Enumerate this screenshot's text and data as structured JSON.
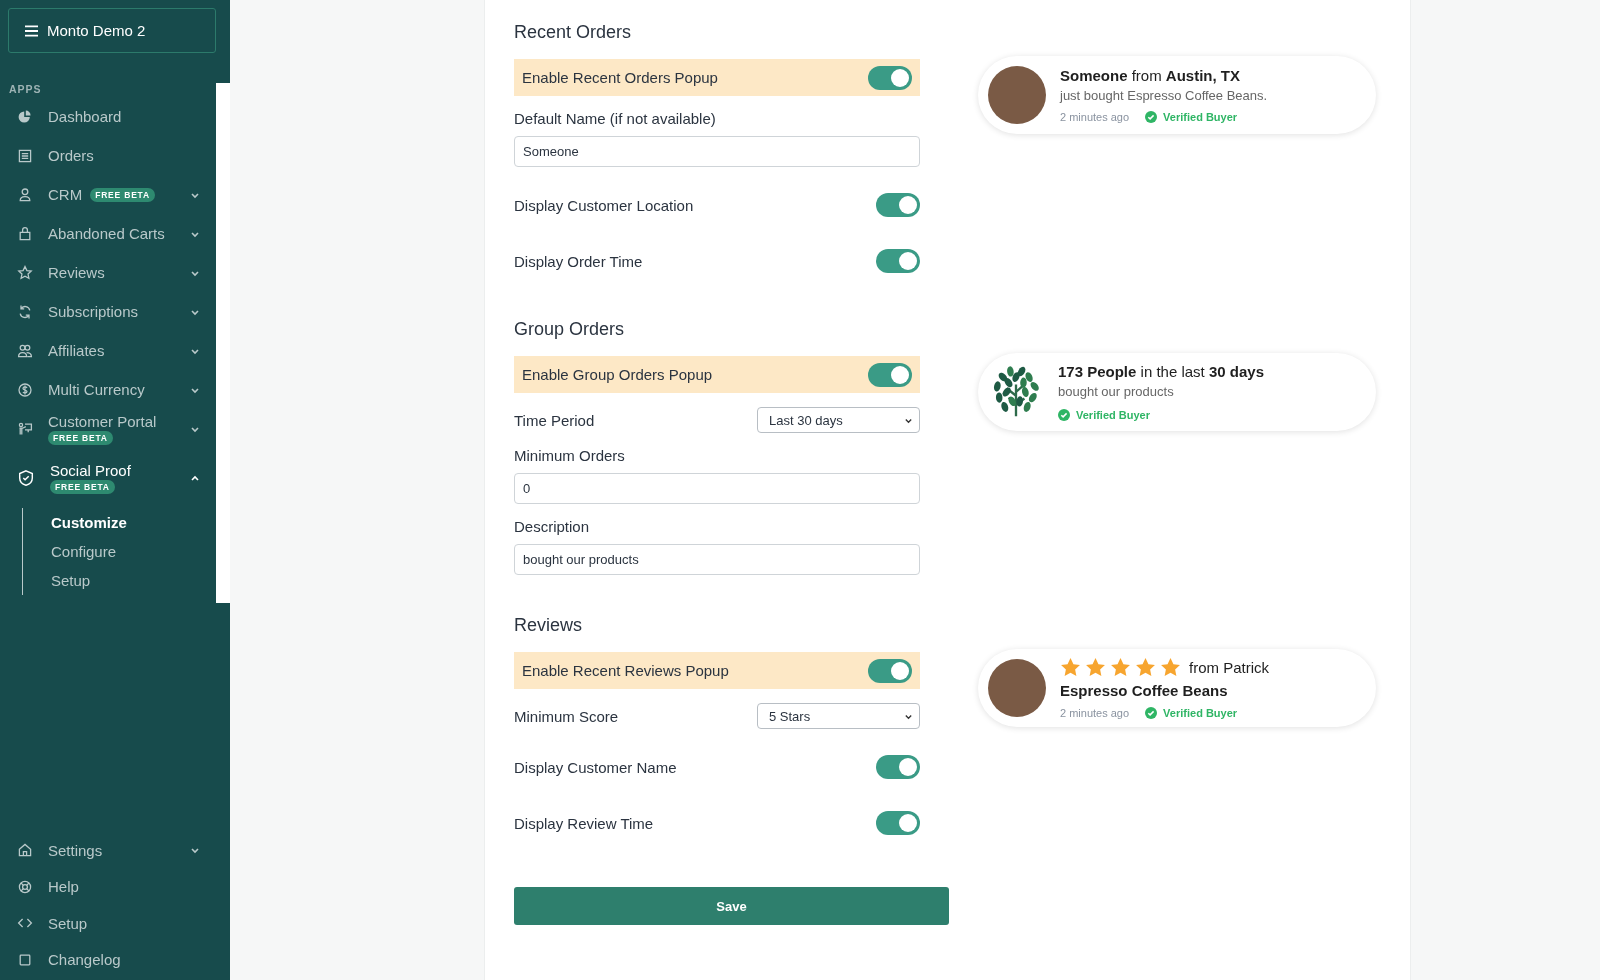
{
  "sidebar": {
    "title": "Monto Demo 2",
    "section_label": "APPS",
    "items": [
      {
        "label": "Dashboard",
        "selected": false
      },
      {
        "label": "Orders",
        "selected": false
      },
      {
        "label": "CRM",
        "badge": "FREE BETA",
        "badge_inline": true,
        "expanded": false,
        "selected": false
      },
      {
        "label": "Abandoned Carts",
        "expanded": false,
        "selected": false
      },
      {
        "label": "Reviews",
        "expanded": false,
        "selected": false
      },
      {
        "label": "Subscriptions",
        "expanded": false,
        "selected": false
      },
      {
        "label": "Affiliates",
        "expanded": false,
        "selected": false
      },
      {
        "label": "Multi Currency",
        "expanded": false,
        "selected": false
      },
      {
        "label": "Customer Portal",
        "badge": "FREE BETA",
        "badge_inline": false,
        "expanded": false,
        "selected": false
      },
      {
        "label": "Social Proof",
        "badge": "FREE BETA",
        "badge_inline": false,
        "expanded": true,
        "selected": true,
        "children": [
          {
            "label": "Customize",
            "selected": true
          },
          {
            "label": "Configure",
            "selected": false
          },
          {
            "label": "Setup",
            "selected": false
          }
        ]
      }
    ],
    "footer_items": [
      {
        "label": "Settings",
        "expanded": false
      },
      {
        "label": "Help"
      },
      {
        "label": "Setup"
      },
      {
        "label": "Changelog"
      }
    ]
  },
  "sections": [
    {
      "title": "Recent Orders",
      "rows": [
        {
          "kind": "highlight-toggle",
          "label": "Enable Recent Orders Popup",
          "on": true
        },
        {
          "kind": "text-field",
          "label": "Default Name (if not available)",
          "value": "Someone"
        },
        {
          "kind": "toggle",
          "label": "Display Customer Location",
          "on": true
        },
        {
          "kind": "toggle",
          "label": "Display Order Time",
          "on": true
        }
      ],
      "preview": {
        "kind": "order",
        "headline": "**Someone** from **Austin, TX**",
        "line": "just bought Espresso Coffee Beans.",
        "time": "2 minutes ago",
        "badge": "Verified Buyer"
      }
    },
    {
      "title": "Group Orders",
      "rows": [
        {
          "kind": "highlight-toggle",
          "label": "Enable Group Orders Popup",
          "on": true
        },
        {
          "kind": "select",
          "label": "Time Period",
          "value": "Last 30 days"
        },
        {
          "kind": "text-field",
          "label": "Minimum Orders",
          "value": "0"
        },
        {
          "kind": "text-field",
          "label": "Description",
          "value": "bought our products"
        }
      ],
      "preview": {
        "kind": "group",
        "headline": "**173 People** in the last **30 days**",
        "line": "bought our products",
        "badge": "Verified Buyer"
      }
    },
    {
      "title": "Reviews",
      "rows": [
        {
          "kind": "highlight-toggle",
          "label": "Enable Recent Reviews Popup",
          "on": true
        },
        {
          "kind": "select",
          "label": "Minimum Score",
          "value": "5 Stars"
        },
        {
          "kind": "toggle",
          "label": "Display Customer Name",
          "on": true
        },
        {
          "kind": "toggle",
          "label": "Display Review Time",
          "on": true
        }
      ],
      "preview": {
        "kind": "review",
        "stars": 5,
        "from": "from Patrick",
        "product": "Espresso Coffee Beans",
        "time": "2 minutes ago",
        "badge": "Verified Buyer"
      }
    }
  ],
  "save_button": "Save"
}
